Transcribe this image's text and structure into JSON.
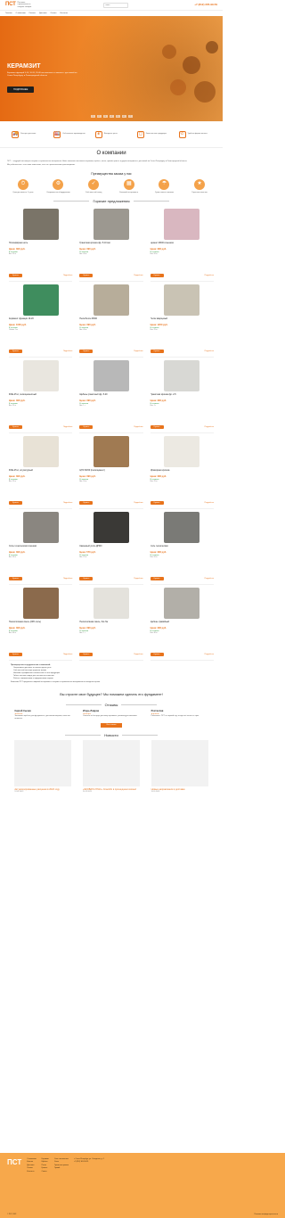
{
  "top": {
    "logo": "ПСТ",
    "logo_sub": "Поставка строительных и сыпучих товаров",
    "search_placeholder": "Поиск",
    "phone": "+7 (812) 305-99-59"
  },
  "nav": [
    "Главная",
    "О компании",
    "Каталог",
    "Доставка",
    "Оплата",
    "Контакты"
  ],
  "hero": {
    "title": "КЕРАМЗИТ",
    "text": "Керамзит фракций 5-10, 10-20, 20-40 мм навалом и в мешках с доставкой по Санкт-Петербургу и Ленинградской области",
    "button": "ПОДРОБНЕЕ",
    "slides": [
      "1",
      "2",
      "3",
      "4",
      "5",
      "6",
      "7"
    ]
  },
  "features": [
    {
      "icon": "truck-icon",
      "glyph": "🚚",
      "text": "Быстрая доставка"
    },
    {
      "icon": "factory-icon",
      "glyph": "🏭",
      "text": "Собственное производство"
    },
    {
      "icon": "wallet-icon",
      "glyph": "₽",
      "text": "Выгодные цены"
    },
    {
      "icon": "bag-icon",
      "glyph": "◻",
      "text": "Качественная продукция"
    },
    {
      "icon": "phone-icon",
      "glyph": "✆",
      "text": "Удобная форма оплаты"
    }
  ],
  "about": {
    "title": "О компании",
    "p1": "ПСТ — ведущий поставщик сыпучих и строительных материалов. Наша компания поставляет керамзит, щебень, песок, гравий, цемент и другие материалы с доставкой по Санкт-Петербургу и Ленинградской области.",
    "p2": "Мы работаем как с частными клиентами, так и со строительными организациями."
  },
  "advantages": {
    "title": "Преимущества заказа у нас",
    "items": [
      {
        "glyph": "⏱",
        "text": "Срок доставки от 1 суток"
      },
      {
        "glyph": "⚙",
        "text": "Современное оборудование"
      },
      {
        "glyph": "✓",
        "text": "Собственный склад"
      },
      {
        "glyph": "▦",
        "text": "Большой ассортимент"
      },
      {
        "glyph": "☂",
        "text": "Сухие смеси в мешках"
      },
      {
        "glyph": "★",
        "text": "Гарантия качества"
      }
    ]
  },
  "products_title": "Горячие предложения",
  "products": [
    {
      "name": "Полиэфирная нить",
      "price": "Цена: 390 руб.",
      "stock": "В наличии",
      "meta": "Вес: 25 кг",
      "img": "#7a7468"
    },
    {
      "name": "Гранитная крошка фр. 5-10 мм",
      "price": "Цена: 390 руб.",
      "stock": "В наличии",
      "meta": "Вес: 40 кг",
      "img": "#9c9890"
    },
    {
      "name": "Цемент М400 в мешках",
      "price": "Цена: 390 руб.",
      "stock": "В наличии",
      "meta": "Вес: 50 кг",
      "img": "#d9b7c0"
    },
    {
      "name": "Керамзит фракции 10-20",
      "price": "Цена: 1000 руб.",
      "stock": "В наличии",
      "meta": "Объём: 1 м³",
      "img": "#3f8d5e"
    },
    {
      "name": "Пескобетон М300",
      "price": "Цена: 390 руб.",
      "stock": "В наличии",
      "meta": "Вес: 40 кг",
      "img": "#b7ad9a"
    },
    {
      "name": "Песок кварцевый",
      "price": "Цена: 1200 руб.",
      "stock": "В наличии",
      "meta": "Вес: 25 кг",
      "img": "#c9c3b4"
    },
    {
      "name": "ФСЕ-25 кг, пескоцементный",
      "price": "Цена: 390 руб.",
      "stock": "В наличии",
      "meta": "Вес: 25 кг",
      "img": "#e9e6df"
    },
    {
      "name": "Щебень гранитный фр. 5-20",
      "price": "Цена: 390 руб.",
      "stock": "В наличии",
      "meta": "Вес: 1 т",
      "img": "#b8b8b8"
    },
    {
      "name": "Гранитная крошка фр. 2-5",
      "price": "Цена: 390 руб.",
      "stock": "В наличии",
      "meta": "Вес: 1 т",
      "img": "#d8d8d4"
    },
    {
      "name": "ФСЕ-25 кг, штукатурный",
      "price": "Цена: 390 руб.",
      "stock": "В наличии",
      "meta": "Вес: 25 кг",
      "img": "#e8e2d6"
    },
    {
      "name": "ЦПС М150 (пескоцемент)",
      "price": "Цена: 390 руб.",
      "stock": "В наличии",
      "meta": "Вес: 50 кг",
      "img": "#a07a52"
    },
    {
      "name": "Мраморная крошка",
      "price": "Цена: 390 руб.",
      "stock": "В наличии",
      "meta": "Вес: 25 кг",
      "img": "#ece9e2"
    },
    {
      "name": "Соль техническая в мешках",
      "price": "Цена: 390 руб.",
      "stock": "В наличии",
      "meta": "Вес: 50 кг",
      "img": "#8a8680"
    },
    {
      "name": "Каменный уголь ДПКО",
      "price": "Цена: 570 руб.",
      "stock": "В наличии",
      "meta": "Вес: 25 кг",
      "img": "#3a3936"
    },
    {
      "name": "Соль техническая",
      "price": "Цена: 390 руб.",
      "stock": "В наличии",
      "meta": "Вес: 50 кг",
      "img": "#7a7a76"
    },
    {
      "name": "Пескосоляная смесь (20% соль)",
      "price": "Цена: 390 руб.",
      "stock": "В наличии",
      "meta": "Вес: 40 кг",
      "img": "#8b6a4c"
    },
    {
      "name": "Пескосоляная смесь, биг-бэг",
      "price": "Цена: 390 руб.",
      "stock": "В наличии",
      "meta": "Вес: 1 т",
      "img": "#e4e2dc"
    },
    {
      "name": "Щебень гравийный",
      "price": "Цена: 390 руб.",
      "stock": "В наличии",
      "meta": "Вес: 40 кг",
      "img": "#b2afa8"
    }
  ],
  "buy_label": "Купить",
  "more_label": "Подробнее",
  "info": {
    "title": "Преимущества сотрудничества с компанией:",
    "items": [
      "Оперативная доставка в течение одних суток",
      "Собственный автопарк грузовых машин",
      "Наличие сертификатов соответствия на всю продукцию",
      "Гибкая система скидок для постоянных клиентов",
      "Работа с физическими и юридическими лицами"
    ],
    "p": "Компания ПСТ предлагает широкий ассортимент сыпучих и строительных материалов по выгодным ценам."
  },
  "cta": "Вы строите свое будущее? Мы поможем сделать его фундамент!",
  "reviews": {
    "title": "Отзывы",
    "items": [
      {
        "name": "Сергей Сычев",
        "text": "Заказывал щебень для фундамента, доставили вовремя, качество отличное."
      },
      {
        "name": "Игорь Лавров",
        "text": "Спасибо за быструю доставку керамзита, рекомендую компанию."
      },
      {
        "name": "Ростислав",
        "text": "Работаем с ПСТ не первый год, всегда всё четко и в срок."
      }
    ],
    "button": "Все отзывы"
  },
  "news": {
    "title": "Новости",
    "items": [
      {
        "title": "Актуализированные расценки в 2022 году",
        "date": "12.01.2022"
      },
      {
        "title": "«ЭКОВАТА-ГЛАС» Спасибо в прошедшем сезоне!",
        "date": "20.12.2021"
      },
      {
        "title": "Новые направления в доставке",
        "date": "15.11.2021"
      }
    ]
  },
  "footer": {
    "logo": "ПСТ",
    "col1": [
      "О компании",
      "Каталог",
      "Доставка",
      "Оплата",
      "Контакты"
    ],
    "col2": [
      "Керамзит",
      "Щебень",
      "Песок",
      "Цемент",
      "Смеси"
    ],
    "col3": [
      "Соль техническая",
      "Уголь",
      "Гранитная крошка",
      "Гравий"
    ],
    "address": "г. Санкт-Петербург, ул. Складская, д. 1",
    "phone": "+7 (812) 305-99-59",
    "copy": "© ПСТ, 2022",
    "policy": "Политика конфиденциальности"
  }
}
